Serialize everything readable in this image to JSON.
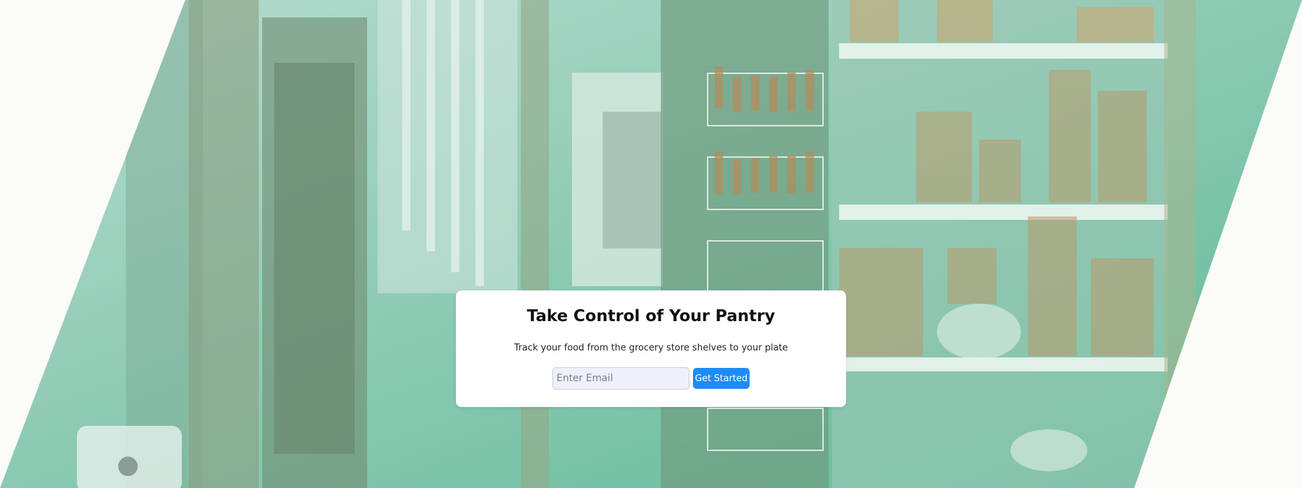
{
  "hero": {
    "title": "Take Control of Your Pantry",
    "subtitle": "Track your food from the grocery store shelves to your plate",
    "email_placeholder": "Enter Email",
    "cta_label": "Get Started"
  },
  "colors": {
    "page_background": "#fbfbf8",
    "overlay_green": "#5fb998",
    "button": "#1d8cf8"
  }
}
